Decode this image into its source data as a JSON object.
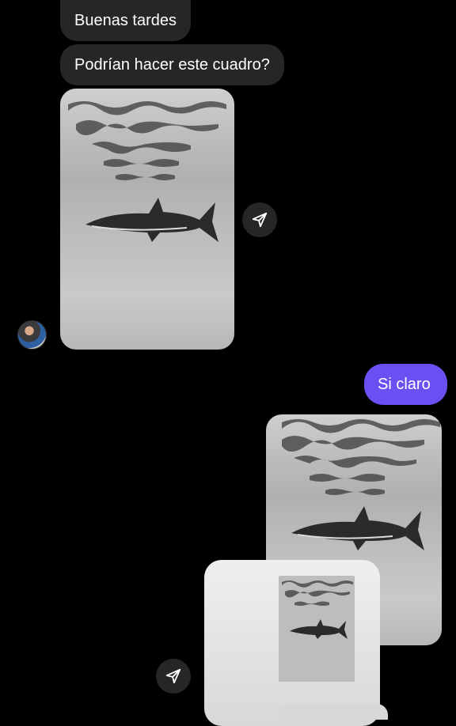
{
  "messages": {
    "incoming_1": "Buenas tardes",
    "incoming_2": "Podrían hacer este cuadro?",
    "outgoing_1": "Si claro"
  },
  "icons": {
    "share": "paper-plane-icon",
    "avatar": "contact-avatar"
  },
  "colors": {
    "background": "#000000",
    "incoming_bubble": "#262626",
    "outgoing_bubble": "#6a4ff2",
    "text": "#ffffff"
  }
}
